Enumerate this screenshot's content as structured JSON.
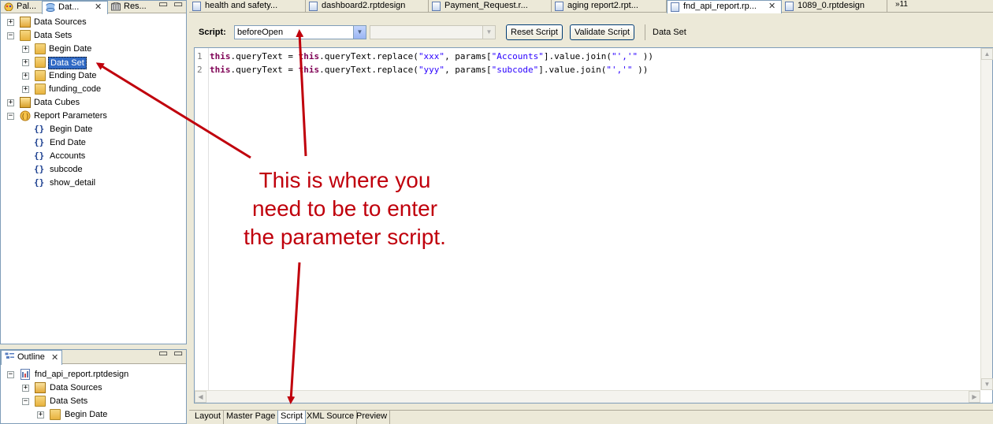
{
  "left_panel": {
    "tabs": [
      {
        "label": "Pal..."
      },
      {
        "label": "Dat..."
      },
      {
        "label": "Res..."
      }
    ],
    "tree": {
      "data_sources": "Data Sources",
      "data_sets": "Data Sets",
      "data_set_children": [
        "Begin Date",
        "Data Set",
        "Ending Date",
        "funding_code"
      ],
      "data_cubes": "Data Cubes",
      "report_parameters": "Report Parameters",
      "parameters": [
        "Begin Date",
        "End Date",
        "Accounts",
        "subcode",
        "show_detail"
      ]
    }
  },
  "outline_panel": {
    "title": "Outline",
    "root": "fnd_api_report.rptdesign",
    "children": [
      "Data Sources",
      "Data Sets",
      "Begin Date"
    ]
  },
  "editor_tabs": [
    {
      "label": "health and safety..."
    },
    {
      "label": "dashboard2.rptdesign"
    },
    {
      "label": "Payment_Request.r..."
    },
    {
      "label": "aging report2.rpt..."
    },
    {
      "label": "fnd_api_report.rp..."
    },
    {
      "label": "1089_0.rptdesign"
    },
    {
      "label": "»11"
    }
  ],
  "script_toolbar": {
    "script_label": "Script:",
    "event_value": "beforeOpen",
    "reset_button": "Reset Script",
    "validate_button": "Validate Script",
    "context_label": "Data Set"
  },
  "code": {
    "lines": [
      {
        "number": "1",
        "parts": [
          {
            "t": "this",
            "c": "kw"
          },
          {
            "t": ".queryText = ",
            "c": ""
          },
          {
            "t": "this",
            "c": "kw"
          },
          {
            "t": ".queryText.replace(",
            "c": ""
          },
          {
            "t": "\"xxx\"",
            "c": "str"
          },
          {
            "t": ", params[",
            "c": ""
          },
          {
            "t": "\"Accounts\"",
            "c": "str"
          },
          {
            "t": "].value.join(",
            "c": ""
          },
          {
            "t": "\"','\"",
            "c": "str"
          },
          {
            "t": " ))",
            "c": ""
          }
        ]
      },
      {
        "number": "2",
        "parts": [
          {
            "t": "this",
            "c": "kw"
          },
          {
            "t": ".queryText = ",
            "c": ""
          },
          {
            "t": "this",
            "c": "kw"
          },
          {
            "t": ".queryText.replace(",
            "c": ""
          },
          {
            "t": "\"yyy\"",
            "c": "str"
          },
          {
            "t": ", params[",
            "c": ""
          },
          {
            "t": "\"subcode\"",
            "c": "str"
          },
          {
            "t": "].value.join(",
            "c": ""
          },
          {
            "t": "\"','\"",
            "c": "str"
          },
          {
            "t": " ))",
            "c": ""
          }
        ]
      }
    ]
  },
  "page_tabs": [
    {
      "label": "Layout"
    },
    {
      "label": "Master Page"
    },
    {
      "label": "Script"
    },
    {
      "label": "XML Source"
    },
    {
      "label": "Preview"
    }
  ],
  "annotation": {
    "lines": [
      "This is where you",
      "need to be to enter",
      "the parameter script."
    ],
    "color": "#c0000c"
  }
}
